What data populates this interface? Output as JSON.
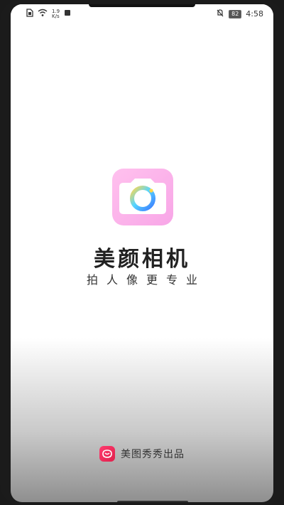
{
  "status_bar": {
    "speed_value": "1.9",
    "speed_unit": "K/s",
    "battery_level": "82",
    "time": "4:58"
  },
  "app": {
    "title": "美颜相机",
    "tagline": "拍人像更专业"
  },
  "footer": {
    "text": "美图秀秀出品"
  },
  "colors": {
    "logo_gradient_start": "#ffc1ee",
    "logo_gradient_end": "#f8a6e7",
    "footer_icon": "#ff3b6f"
  }
}
